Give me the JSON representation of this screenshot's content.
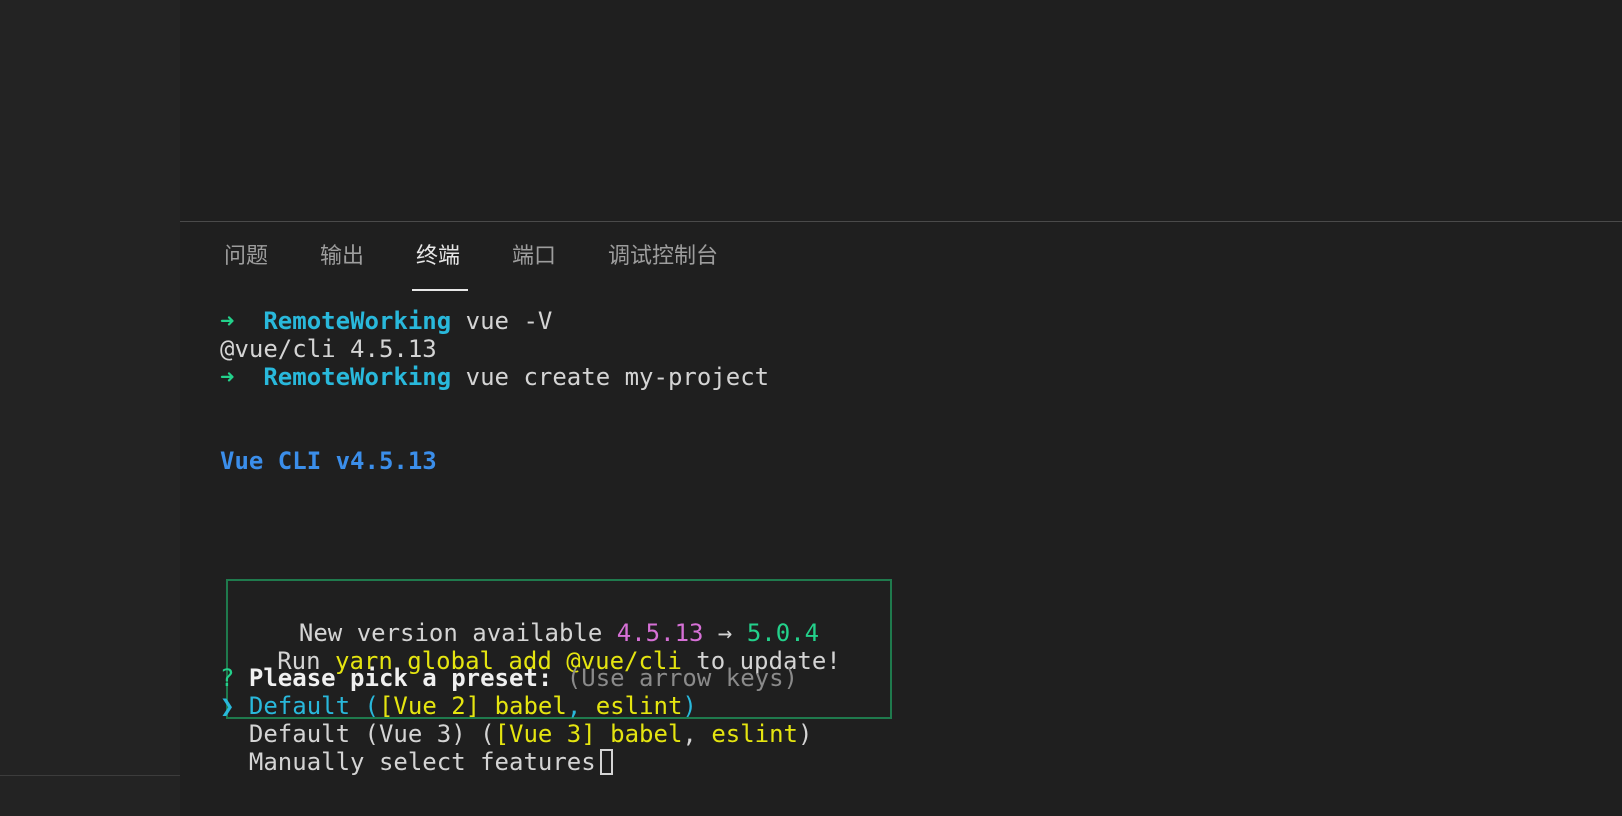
{
  "panel": {
    "tabs": [
      {
        "label": "问题",
        "active": false
      },
      {
        "label": "输出",
        "active": false
      },
      {
        "label": "终端",
        "active": true
      },
      {
        "label": "端口",
        "active": false
      },
      {
        "label": "调试控制台",
        "active": false
      }
    ]
  },
  "terminal": {
    "prompt_arrow": "➜",
    "prompt_dir": "RemoteWorking",
    "cmd1": "vue -V",
    "output1": "@vue/cli 4.5.13",
    "cmd2": "vue create my-project",
    "cli_banner": "Vue CLI v4.5.13",
    "update_box": {
      "line1_prefix": "New version available ",
      "old_version": "4.5.13",
      "arrow": " → ",
      "new_version": "5.0.4",
      "line2_prefix": "Run ",
      "command": "yarn global add @vue/cli",
      "line2_suffix": " to update!"
    },
    "question_mark": "?",
    "question": "Please pick a preset:",
    "hint": "(Use arrow keys)",
    "selector": "❯",
    "options": [
      {
        "name": "Default",
        "open": " (",
        "detail": "[Vue 2] babel",
        "comma": ", ",
        "detail2": "eslint",
        "close": ")",
        "selected": true
      },
      {
        "name": "Default (Vue 3)",
        "open": " (",
        "detail": "[Vue 3] babel",
        "comma": ", ",
        "detail2": "eslint",
        "close": ")",
        "selected": false
      },
      {
        "name": "Manually select features",
        "selected": false
      }
    ]
  },
  "colors": {
    "background": "#1e1e1e",
    "prompt_green": "#23d18b",
    "dir_cyan": "#29b8db",
    "banner_blue": "#3b8eea",
    "version_magenta": "#d670d6",
    "command_yellow": "#e5e510",
    "box_border": "#1f7a4d"
  }
}
